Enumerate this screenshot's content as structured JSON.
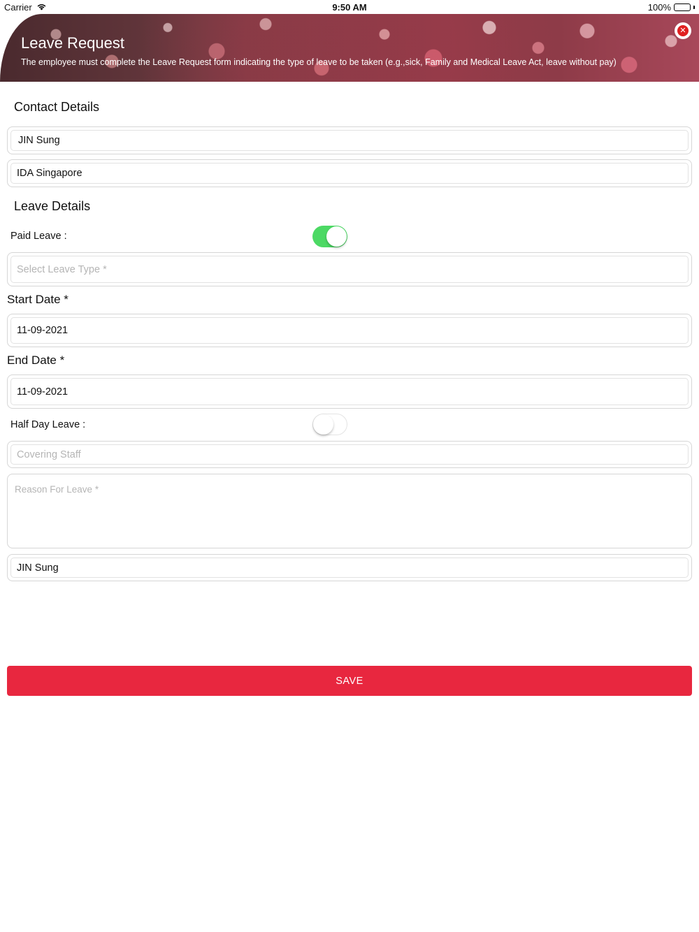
{
  "status_bar": {
    "carrier": "Carrier",
    "time": "9:50 AM",
    "battery": "100%"
  },
  "header": {
    "title": "Leave Request",
    "description": "The employee must complete the Leave Request form indicating the type of leave to be taken (e.g.,sick, Family and Medical Leave Act, leave without pay)"
  },
  "contact": {
    "section_title": "Contact Details",
    "name": "JIN Sung",
    "organization": "IDA Singapore"
  },
  "leave": {
    "section_title": "Leave Details",
    "paid_leave_label": "Paid Leave :",
    "paid_leave_on": true,
    "leave_type_placeholder": "Select Leave Type *",
    "start_date_label": "Start Date *",
    "start_date": "11-09-2021",
    "end_date_label": "End Date *",
    "end_date": "11-09-2021",
    "half_day_label": "Half Day Leave :",
    "half_day_on": false,
    "covering_staff_placeholder": "Covering Staff",
    "reason_placeholder": "Reason For Leave *",
    "approver": "JIN Sung"
  },
  "actions": {
    "save_label": "SAVE"
  },
  "colors": {
    "accent": "#e8273f",
    "toggle_on": "#4cd964",
    "close": "#e02020"
  }
}
